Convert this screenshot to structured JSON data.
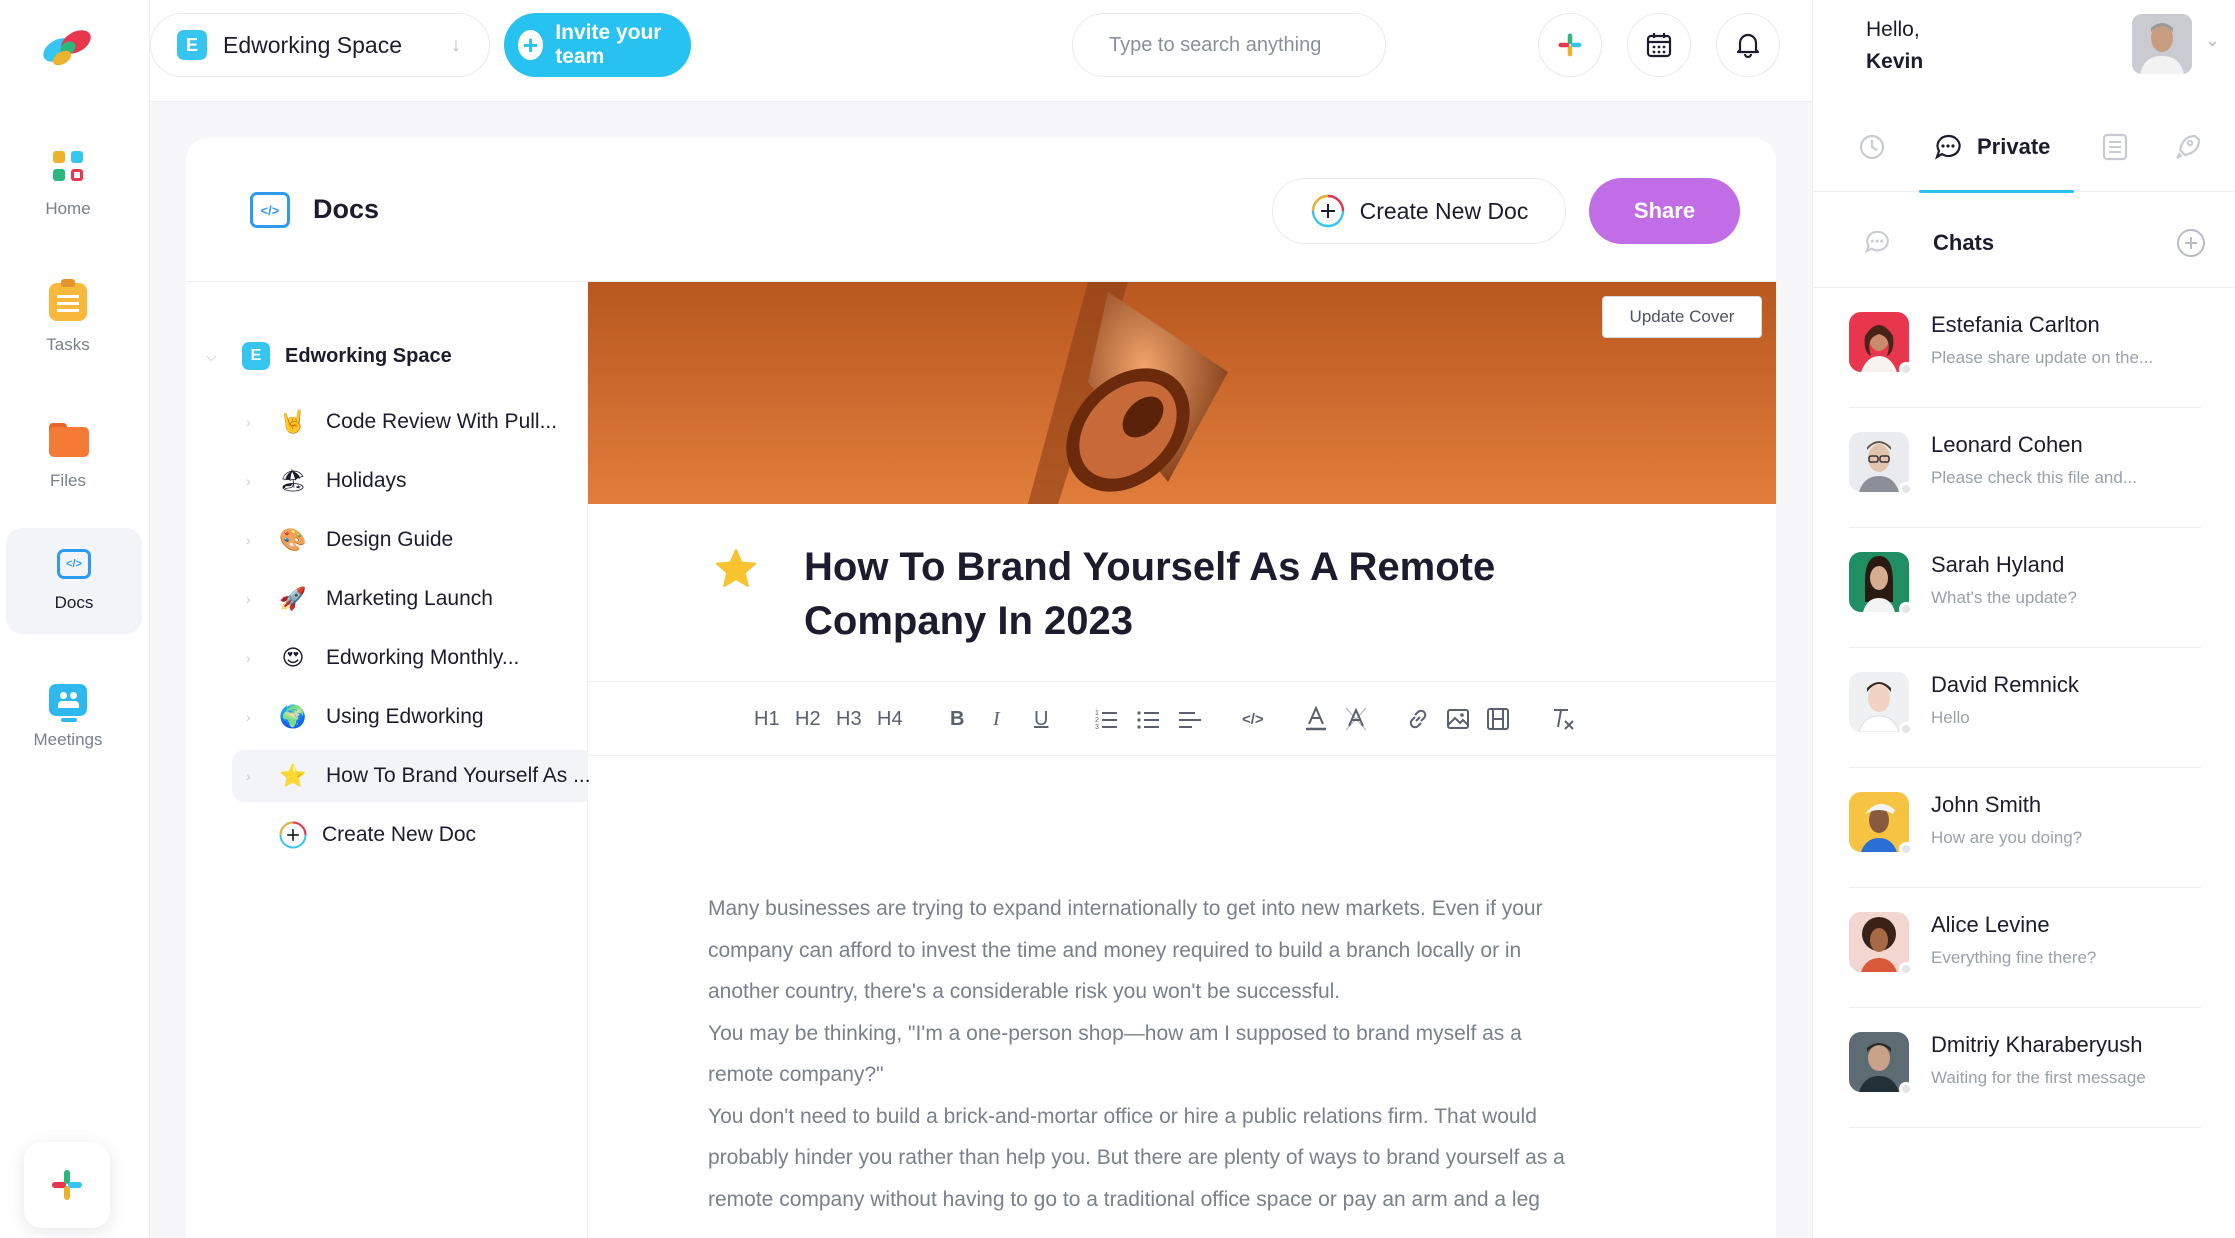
{
  "topbar": {
    "workspace_badge": "E",
    "workspace_name": "Edworking Space",
    "invite_label": "Invite your team",
    "search_placeholder": "Type to search anything"
  },
  "leftnav": {
    "items": [
      {
        "label": "Home",
        "icon": "home-grid-icon"
      },
      {
        "label": "Tasks",
        "icon": "tasks-clipboard-icon"
      },
      {
        "label": "Files",
        "icon": "folder-icon"
      },
      {
        "label": "Docs",
        "icon": "docs-code-icon"
      },
      {
        "label": "Meetings",
        "icon": "meetings-screen-icon"
      }
    ]
  },
  "user": {
    "greeting": "Hello,",
    "name": "Kevin"
  },
  "right_tabs": {
    "active_label": "Private"
  },
  "chats": {
    "header": "Chats",
    "items": [
      {
        "name": "Estefania Carlton",
        "message": "Please share update on the..."
      },
      {
        "name": "Leonard Cohen",
        "message": "Please check this file and..."
      },
      {
        "name": "Sarah Hyland",
        "message": "What's the update?"
      },
      {
        "name": "David Remnick",
        "message": "Hello"
      },
      {
        "name": "John Smith",
        "message": "How are you doing?"
      },
      {
        "name": "Alice Levine",
        "message": "Everything fine there?"
      },
      {
        "name": "Dmitriy Kharaberyush",
        "message": "Waiting for the first message"
      }
    ]
  },
  "docs": {
    "header_title": "Docs",
    "create_new_label": "Create New Doc",
    "share_label": "Share",
    "update_cover_label": "Update Cover",
    "tree": {
      "root_badge": "E",
      "root_label": "Edworking Space",
      "items": [
        {
          "label": "Code Review With Pull...",
          "emoji": "🤘"
        },
        {
          "label": "Holidays",
          "emoji": "🏖"
        },
        {
          "label": "Design Guide",
          "emoji": "🎨"
        },
        {
          "label": "Marketing Launch",
          "emoji": "🚀"
        },
        {
          "label": "Edworking Monthly...",
          "emoji": "😍"
        },
        {
          "label": "Using Edworking",
          "emoji": "🌍"
        },
        {
          "label": "How To Brand Yourself As ...",
          "emoji": "⭐"
        }
      ],
      "create_label": "Create New Doc"
    },
    "title_line1": "How To Brand Yourself As A Remote",
    "title_line2": "Company In 2023",
    "toolbar": [
      "H1",
      "H2",
      "H3",
      "H4",
      "B",
      "I",
      "U"
    ],
    "body_lines": [
      "Many businesses are trying to expand internationally to get into new markets. Even if your",
      "company can afford to invest the time and money required to build a branch locally or in",
      "another country, there's a considerable risk you won't be successful.",
      "You may be thinking, \"I'm a one-person shop—how am I supposed to brand myself as a",
      "remote company?\"",
      "You don't need to build a brick-and-mortar office or hire a public relations firm. That would",
      "probably hinder you rather than help you. But there are plenty of ways to brand yourself as a",
      "remote company without having to go to a traditional office space or pay an arm and a leg"
    ]
  },
  "colors": {
    "accent": "#27c2ef",
    "share": "#c16ee6",
    "cover": "#d9702f"
  }
}
